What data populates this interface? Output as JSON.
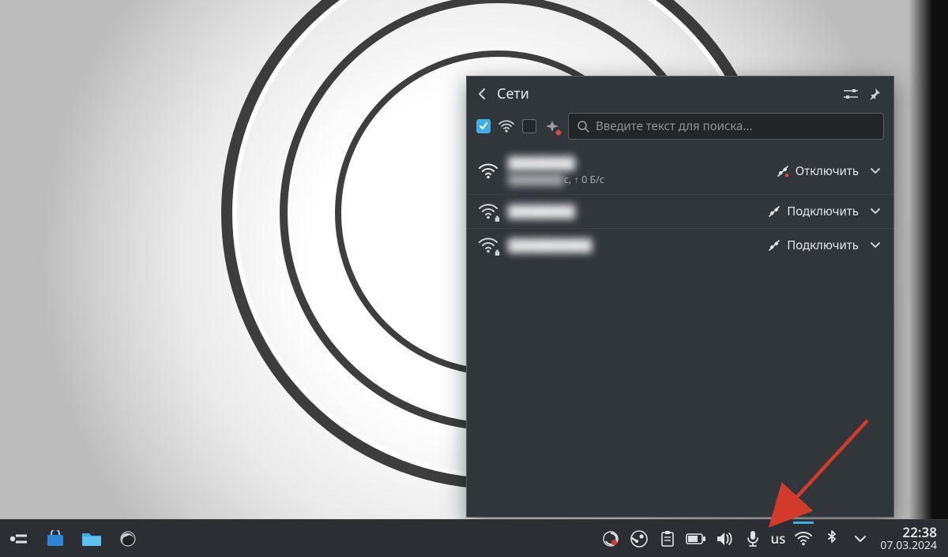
{
  "popup": {
    "title": "Сети",
    "search_placeholder": "Введите текст для поиска...",
    "filters": {
      "wifi_checked": true,
      "ethernet_checked": false
    },
    "networks": [
      {
        "ssid": "████████",
        "sub_prefix": "████████",
        "sub_stats": "с, ↑ 0 Б/с",
        "action_label": "Отключить",
        "secured": false,
        "connected": true
      },
      {
        "ssid": "████████",
        "action_label": "Подключить",
        "secured": true,
        "connected": false
      },
      {
        "ssid": "██████████",
        "action_label": "Подключить",
        "secured": true,
        "connected": false
      }
    ]
  },
  "taskbar": {
    "keyboard_layout": "us",
    "time": "22:38",
    "date": "07.03.2024"
  }
}
